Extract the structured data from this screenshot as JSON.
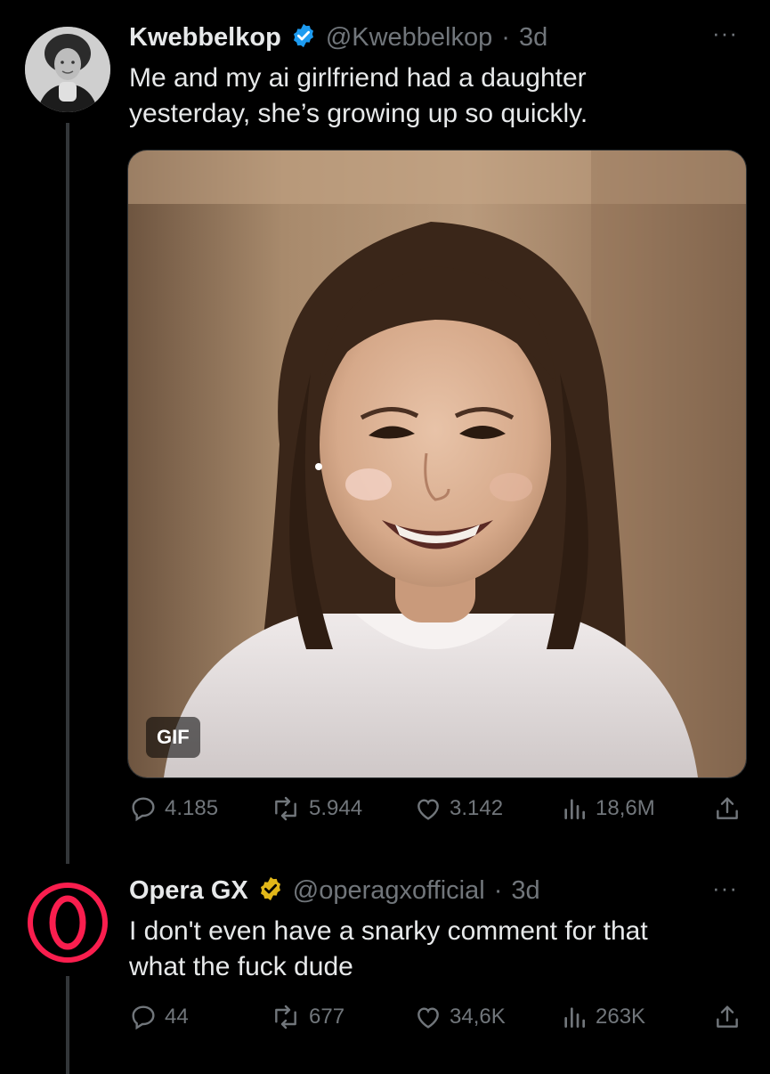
{
  "tweets": [
    {
      "name": "Kwebbelkop",
      "handle": "@Kwebbelkop",
      "separator": "·",
      "time": "3d",
      "text_line1": "Me and my ai girlfriend had a daughter",
      "text_line2": "yesterday, she’s growing up so quickly.",
      "media_badge": "GIF",
      "more": "···",
      "stats": {
        "replies": "4.185",
        "reposts": "5.944",
        "likes": "3.142",
        "views": "18,6M"
      },
      "verified_color": "#1d9bf0"
    },
    {
      "name": "Opera GX",
      "handle": "@operagxofficial",
      "separator": "·",
      "time": "3d",
      "text_line1": "I don't even have a snarky comment for that",
      "text_line2": "what the fuck dude",
      "more": "···",
      "stats": {
        "replies": "44",
        "reposts": "677",
        "likes": "34,6K",
        "views": "263K"
      },
      "verified_color": "#e2b719",
      "brand_color": "#fa1e4e"
    }
  ],
  "icons": [
    "reply-icon",
    "repost-icon",
    "like-icon",
    "views-icon",
    "share-icon",
    "verified-badge-icon",
    "opera-gx-logo"
  ]
}
